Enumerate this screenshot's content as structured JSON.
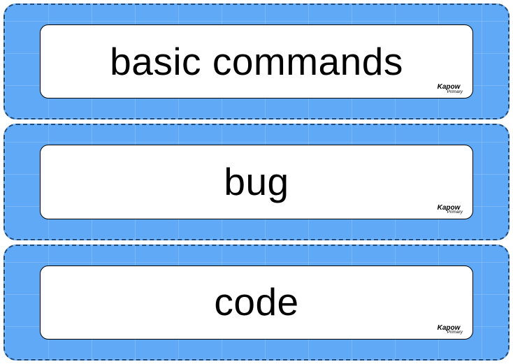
{
  "brand": {
    "name": "Kapow",
    "sub": "Primary"
  },
  "cards": [
    {
      "word": "basic commands"
    },
    {
      "word": "bug"
    },
    {
      "word": "code"
    }
  ]
}
